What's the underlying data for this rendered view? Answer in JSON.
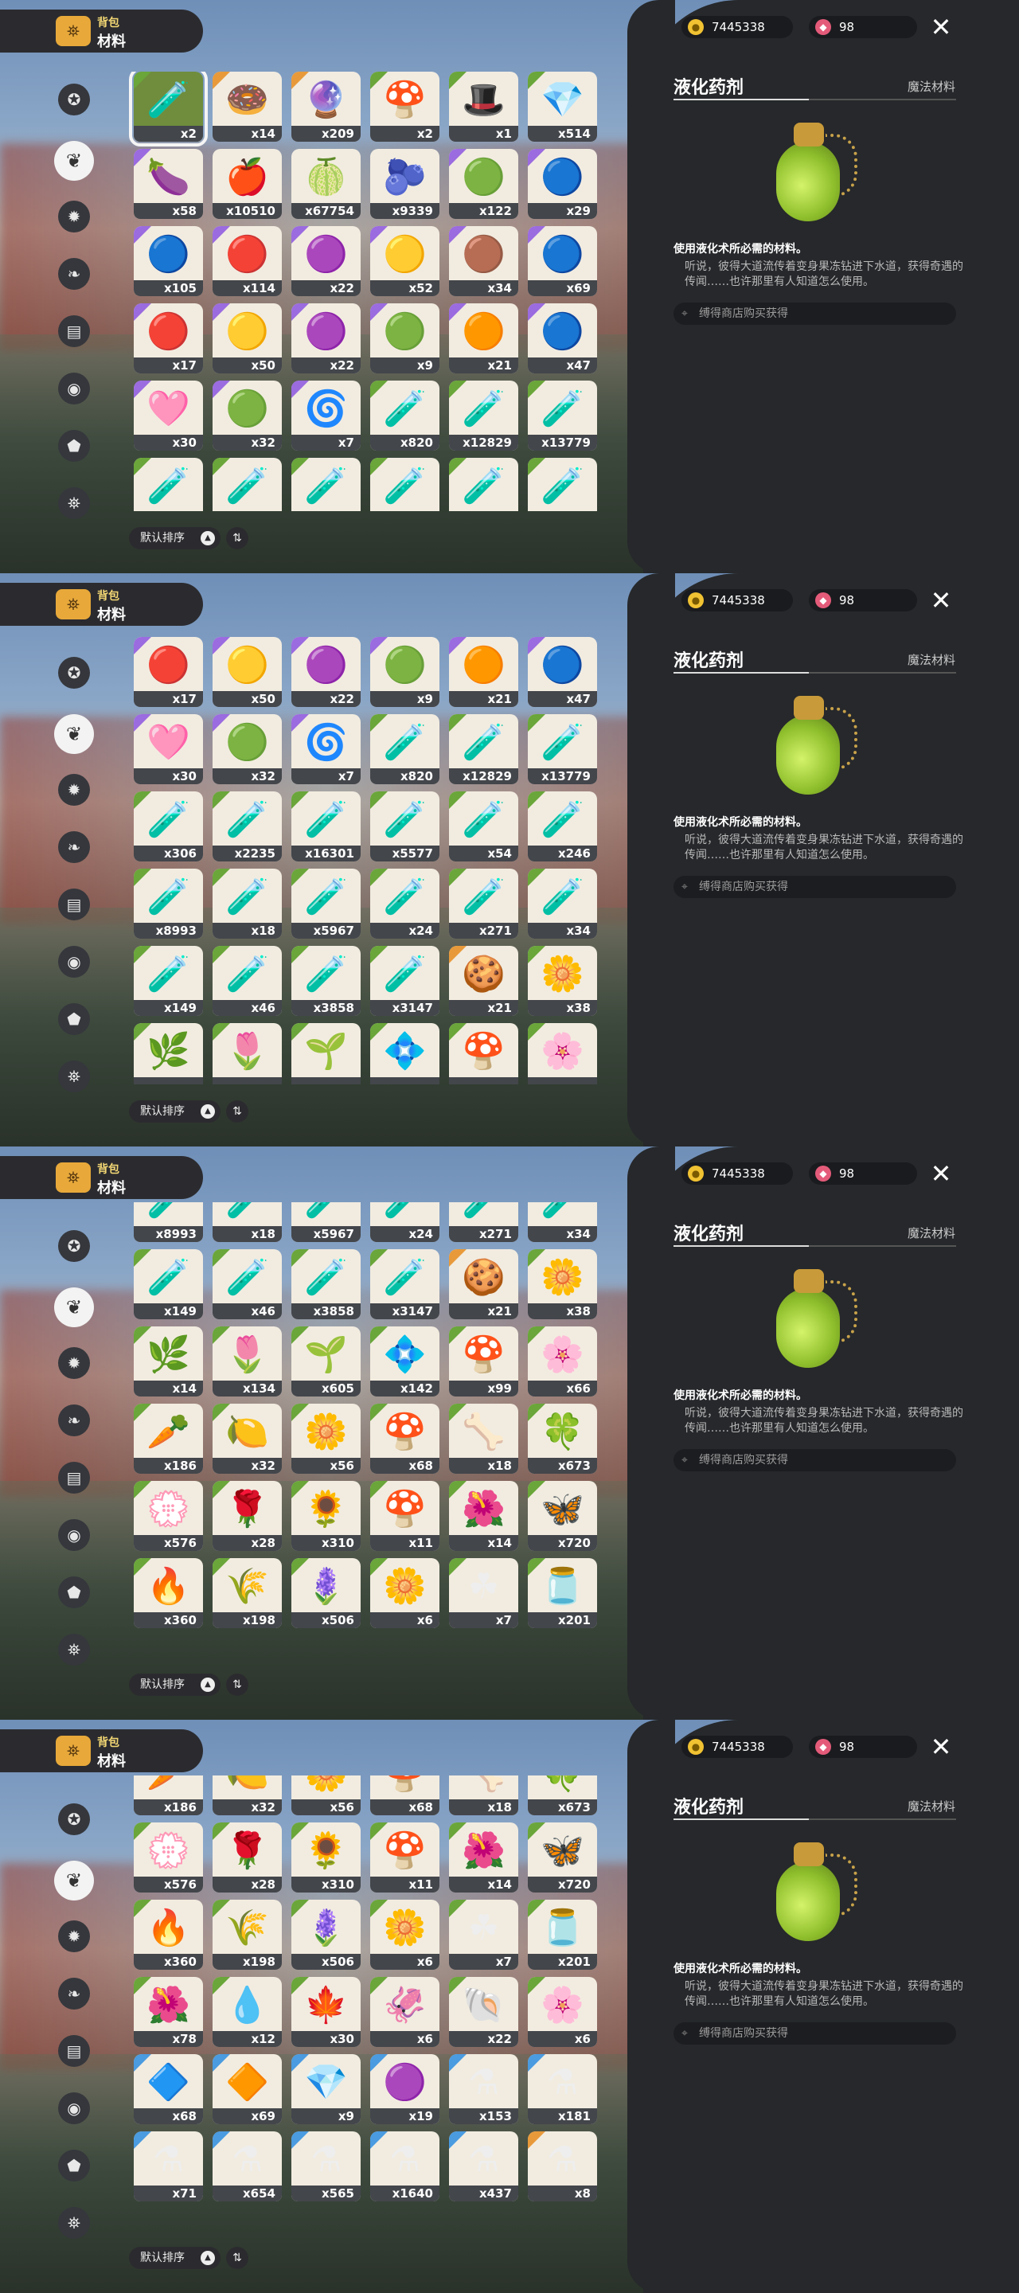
{
  "header": {
    "title": "背包",
    "subtitle": "材料"
  },
  "currency": {
    "gold": "7445338",
    "gems": "98"
  },
  "categories": [
    "star",
    "leaf",
    "gear",
    "leaf-dark",
    "scroll",
    "tag",
    "acorn",
    "bag"
  ],
  "sort": {
    "label": "默认排序"
  },
  "detail": {
    "name": "液化药剂",
    "type": "魔法材料",
    "description": "使用液化术所必需的材料。",
    "lore": "听说，彼得大道流传着变身果冻钻进下水道，获得奇遇的传闻……也许那里有人知道怎么使用。",
    "source": "缚得商店购买获得"
  },
  "colors": {
    "purple": "#9b6be0",
    "orange": "#e89a3a",
    "green": "#6aa63a",
    "blue": "#4a9be0",
    "accent": "#f3d774"
  },
  "frames": [
    {
      "rows": [
        [
          {
            "g": "🧪",
            "c": "x2",
            "r": "green",
            "sel": true
          },
          {
            "g": "🍩",
            "c": "x14",
            "r": "orange"
          },
          {
            "g": "🔮",
            "c": "x209",
            "r": "orange"
          },
          {
            "g": "🍄",
            "c": "x2",
            "r": "green"
          },
          {
            "g": "🎩",
            "c": "x1",
            "r": "green"
          },
          {
            "g": "💎",
            "c": "x514",
            "r": "green"
          }
        ],
        [
          {
            "g": "🍆",
            "c": "x58",
            "r": "purple"
          },
          {
            "g": "🍎",
            "c": "x10510",
            "r": ""
          },
          {
            "g": "🍈",
            "c": "x67754",
            "r": ""
          },
          {
            "g": "🫐",
            "c": "x9339",
            "r": ""
          },
          {
            "g": "🟢",
            "c": "x122",
            "r": "purple"
          },
          {
            "g": "🔵",
            "c": "x29",
            "r": "purple"
          }
        ],
        [
          {
            "g": "🔵",
            "c": "x105",
            "r": "purple"
          },
          {
            "g": "🔴",
            "c": "x114",
            "r": "purple"
          },
          {
            "g": "🟣",
            "c": "x22",
            "r": "purple"
          },
          {
            "g": "🟡",
            "c": "x52",
            "r": "purple"
          },
          {
            "g": "🟤",
            "c": "x34",
            "r": "purple"
          },
          {
            "g": "🔵",
            "c": "x69",
            "r": "purple"
          }
        ],
        [
          {
            "g": "🔴",
            "c": "x17",
            "r": "purple"
          },
          {
            "g": "🟡",
            "c": "x50",
            "r": "purple"
          },
          {
            "g": "🟣",
            "c": "x22",
            "r": "purple"
          },
          {
            "g": "🟢",
            "c": "x9",
            "r": "purple"
          },
          {
            "g": "🟠",
            "c": "x21",
            "r": "purple"
          },
          {
            "g": "🔵",
            "c": "x47",
            "r": "purple"
          }
        ],
        [
          {
            "g": "🩷",
            "c": "x30",
            "r": "purple"
          },
          {
            "g": "🟢",
            "c": "x32",
            "r": "purple"
          },
          {
            "g": "🌀",
            "c": "x7",
            "r": "purple"
          },
          {
            "g": "🧪",
            "c": "x820",
            "r": "green"
          },
          {
            "g": "🧪",
            "c": "x12829",
            "r": "green"
          },
          {
            "g": "🧪",
            "c": "x13779",
            "r": "green"
          }
        ],
        [
          {
            "g": "🧪",
            "c": "",
            "r": "green"
          },
          {
            "g": "🧪",
            "c": "",
            "r": "green"
          },
          {
            "g": "🧪",
            "c": "",
            "r": "green"
          },
          {
            "g": "🧪",
            "c": "",
            "r": "green"
          },
          {
            "g": "🧪",
            "c": "",
            "r": "green"
          },
          {
            "g": "🧪",
            "c": "",
            "r": "green"
          }
        ]
      ]
    },
    {
      "rows": [
        [
          {
            "g": "🔴",
            "c": "x17",
            "r": "purple"
          },
          {
            "g": "🟡",
            "c": "x50",
            "r": "purple"
          },
          {
            "g": "🟣",
            "c": "x22",
            "r": "purple"
          },
          {
            "g": "🟢",
            "c": "x9",
            "r": "purple"
          },
          {
            "g": "🟠",
            "c": "x21",
            "r": "purple"
          },
          {
            "g": "🔵",
            "c": "x47",
            "r": "purple"
          }
        ],
        [
          {
            "g": "🩷",
            "c": "x30",
            "r": "purple"
          },
          {
            "g": "🟢",
            "c": "x32",
            "r": "purple"
          },
          {
            "g": "🌀",
            "c": "x7",
            "r": "purple"
          },
          {
            "g": "🧪",
            "c": "x820",
            "r": "green"
          },
          {
            "g": "🧪",
            "c": "x12829",
            "r": "green"
          },
          {
            "g": "🧪",
            "c": "x13779",
            "r": "green"
          }
        ],
        [
          {
            "g": "🧪",
            "c": "x306",
            "r": "green"
          },
          {
            "g": "🧪",
            "c": "x2235",
            "r": "green"
          },
          {
            "g": "🧪",
            "c": "x16301",
            "r": "green"
          },
          {
            "g": "🧪",
            "c": "x5577",
            "r": "green"
          },
          {
            "g": "🧪",
            "c": "x54",
            "r": "green"
          },
          {
            "g": "🧪",
            "c": "x246",
            "r": "green"
          }
        ],
        [
          {
            "g": "🧪",
            "c": "x8993",
            "r": "green"
          },
          {
            "g": "🧪",
            "c": "x18",
            "r": "green"
          },
          {
            "g": "🧪",
            "c": "x5967",
            "r": "green"
          },
          {
            "g": "🧪",
            "c": "x24",
            "r": "green"
          },
          {
            "g": "🧪",
            "c": "x271",
            "r": "green"
          },
          {
            "g": "🧪",
            "c": "x34",
            "r": "green"
          }
        ],
        [
          {
            "g": "🧪",
            "c": "x149",
            "r": "green"
          },
          {
            "g": "🧪",
            "c": "x46",
            "r": "green"
          },
          {
            "g": "🧪",
            "c": "x3858",
            "r": "green"
          },
          {
            "g": "🧪",
            "c": "x3147",
            "r": "green"
          },
          {
            "g": "🍪",
            "c": "x21",
            "r": "orange"
          },
          {
            "g": "🌼",
            "c": "x38",
            "r": "green"
          }
        ],
        [
          {
            "g": "🌿",
            "c": "",
            "r": "green"
          },
          {
            "g": "🌷",
            "c": "",
            "r": "green"
          },
          {
            "g": "🌱",
            "c": "",
            "r": "green"
          },
          {
            "g": "💠",
            "c": "",
            "r": "green"
          },
          {
            "g": "🍄",
            "c": "",
            "r": "green"
          },
          {
            "g": "🌸",
            "c": "",
            "r": "green"
          }
        ]
      ]
    },
    {
      "rows": [
        [
          {
            "g": "🧪",
            "c": "x8993",
            "r": "green"
          },
          {
            "g": "🧪",
            "c": "x18",
            "r": "green"
          },
          {
            "g": "🧪",
            "c": "x5967",
            "r": "green"
          },
          {
            "g": "🧪",
            "c": "x24",
            "r": "green"
          },
          {
            "g": "🧪",
            "c": "x271",
            "r": "green"
          },
          {
            "g": "🧪",
            "c": "x34",
            "r": "green"
          }
        ],
        [
          {
            "g": "🧪",
            "c": "x149",
            "r": "green"
          },
          {
            "g": "🧪",
            "c": "x46",
            "r": "green"
          },
          {
            "g": "🧪",
            "c": "x3858",
            "r": "green"
          },
          {
            "g": "🧪",
            "c": "x3147",
            "r": "green"
          },
          {
            "g": "🍪",
            "c": "x21",
            "r": "orange"
          },
          {
            "g": "🌼",
            "c": "x38",
            "r": "green"
          }
        ],
        [
          {
            "g": "🌿",
            "c": "x14",
            "r": "green"
          },
          {
            "g": "🌷",
            "c": "x134",
            "r": "green"
          },
          {
            "g": "🌱",
            "c": "x605",
            "r": "green"
          },
          {
            "g": "💠",
            "c": "x142",
            "r": "green"
          },
          {
            "g": "🍄",
            "c": "x99",
            "r": "green"
          },
          {
            "g": "🌸",
            "c": "x66",
            "r": "green"
          }
        ],
        [
          {
            "g": "🥕",
            "c": "x186",
            "r": "green"
          },
          {
            "g": "🍋",
            "c": "x32",
            "r": "green"
          },
          {
            "g": "🌼",
            "c": "x56",
            "r": "green"
          },
          {
            "g": "🍄",
            "c": "x68",
            "r": "green"
          },
          {
            "g": "🦴",
            "c": "x18",
            "r": "green"
          },
          {
            "g": "🍀",
            "c": "x673",
            "r": "green"
          }
        ],
        [
          {
            "g": "💮",
            "c": "x576",
            "r": "green"
          },
          {
            "g": "🌹",
            "c": "x28",
            "r": "green"
          },
          {
            "g": "🌻",
            "c": "x310",
            "r": "green"
          },
          {
            "g": "🍄",
            "c": "x11",
            "r": "green"
          },
          {
            "g": "🌺",
            "c": "x14",
            "r": "green"
          },
          {
            "g": "🦋",
            "c": "x720",
            "r": "green"
          }
        ],
        [
          {
            "g": "🔥",
            "c": "x360",
            "r": "green"
          },
          {
            "g": "🌾",
            "c": "x198",
            "r": "green"
          },
          {
            "g": "🪻",
            "c": "x506",
            "r": "green"
          },
          {
            "g": "🌼",
            "c": "x6",
            "r": "green"
          },
          {
            "g": "☘",
            "c": "x7",
            "r": "green"
          },
          {
            "g": "🫙",
            "c": "x201",
            "r": "green"
          }
        ]
      ]
    },
    {
      "rows": [
        [
          {
            "g": "🥕",
            "c": "x186",
            "r": "green"
          },
          {
            "g": "🍋",
            "c": "x32",
            "r": "green"
          },
          {
            "g": "🌼",
            "c": "x56",
            "r": "green"
          },
          {
            "g": "🍄",
            "c": "x68",
            "r": "green"
          },
          {
            "g": "🦴",
            "c": "x18",
            "r": "green"
          },
          {
            "g": "🍀",
            "c": "x673",
            "r": "green"
          }
        ],
        [
          {
            "g": "💮",
            "c": "x576",
            "r": "green"
          },
          {
            "g": "🌹",
            "c": "x28",
            "r": "green"
          },
          {
            "g": "🌻",
            "c": "x310",
            "r": "green"
          },
          {
            "g": "🍄",
            "c": "x11",
            "r": "green"
          },
          {
            "g": "🌺",
            "c": "x14",
            "r": "green"
          },
          {
            "g": "🦋",
            "c": "x720",
            "r": "green"
          }
        ],
        [
          {
            "g": "🔥",
            "c": "x360",
            "r": "green"
          },
          {
            "g": "🌾",
            "c": "x198",
            "r": "green"
          },
          {
            "g": "🪻",
            "c": "x506",
            "r": "green"
          },
          {
            "g": "🌼",
            "c": "x6",
            "r": "green"
          },
          {
            "g": "☘",
            "c": "x7",
            "r": "green"
          },
          {
            "g": "🫙",
            "c": "x201",
            "r": "green"
          }
        ],
        [
          {
            "g": "🌺",
            "c": "x78",
            "r": "green"
          },
          {
            "g": "💧",
            "c": "x12",
            "r": "green"
          },
          {
            "g": "🍁",
            "c": "x30",
            "r": "green"
          },
          {
            "g": "🦑",
            "c": "x6",
            "r": "green"
          },
          {
            "g": "🐚",
            "c": "x22",
            "r": "green"
          },
          {
            "g": "🌸",
            "c": "x6",
            "r": "green"
          }
        ],
        [
          {
            "g": "🔷",
            "c": "x68",
            "r": "blue"
          },
          {
            "g": "🔶",
            "c": "x69",
            "r": "blue"
          },
          {
            "g": "💎",
            "c": "x9",
            "r": "blue"
          },
          {
            "g": "🟣",
            "c": "x19",
            "r": "blue"
          },
          {
            "g": "⚗",
            "c": "x153",
            "r": "blue"
          },
          {
            "g": "⚗",
            "c": "x181",
            "r": "blue"
          }
        ],
        [
          {
            "g": "⚗",
            "c": "x71",
            "r": "blue"
          },
          {
            "g": "⚗",
            "c": "x654",
            "r": "blue"
          },
          {
            "g": "⚗",
            "c": "x565",
            "r": "blue"
          },
          {
            "g": "⚗",
            "c": "x1640",
            "r": "blue"
          },
          {
            "g": "⚗",
            "c": "x437",
            "r": "blue"
          },
          {
            "g": "⚗",
            "c": "x8",
            "r": "orange"
          }
        ]
      ]
    }
  ]
}
